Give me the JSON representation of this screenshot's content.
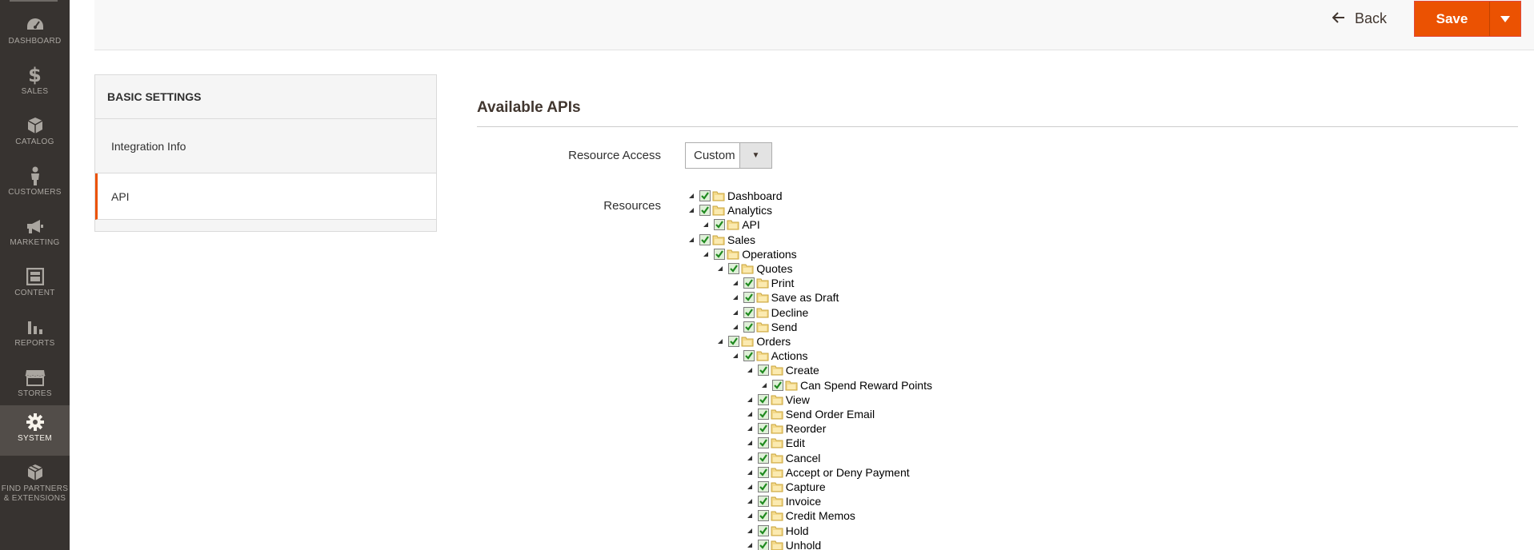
{
  "sidebar": {
    "items": [
      {
        "label": "DASHBOARD",
        "icon": "dashboard-icon"
      },
      {
        "label": "SALES",
        "icon": "dollar-icon"
      },
      {
        "label": "CATALOG",
        "icon": "box-icon"
      },
      {
        "label": "CUSTOMERS",
        "icon": "person-icon"
      },
      {
        "label": "MARKETING",
        "icon": "megaphone-icon"
      },
      {
        "label": "CONTENT",
        "icon": "layout-icon"
      },
      {
        "label": "REPORTS",
        "icon": "bar-chart-icon"
      },
      {
        "label": "STORES",
        "icon": "storefront-icon"
      },
      {
        "label": "SYSTEM",
        "icon": "gear-icon",
        "active": true
      },
      {
        "label": "FIND PARTNERS & EXTENSIONS",
        "icon": "extensions-box-icon"
      }
    ]
  },
  "header": {
    "back_label": "Back",
    "save_label": "Save"
  },
  "tabs": {
    "title": "BASIC SETTINGS",
    "items": [
      {
        "label": "Integration Info",
        "active": false
      },
      {
        "label": "API",
        "active": true
      }
    ]
  },
  "main": {
    "section_title": "Available APIs",
    "resource_access_label": "Resource Access",
    "resource_access_value": "Custom",
    "resources_label": "Resources"
  },
  "tree": [
    {
      "label": "Dashboard",
      "depth": 0,
      "checked": true
    },
    {
      "label": "Analytics",
      "depth": 0,
      "checked": true
    },
    {
      "label": "API",
      "depth": 1,
      "checked": true
    },
    {
      "label": "Sales",
      "depth": 0,
      "checked": true
    },
    {
      "label": "Operations",
      "depth": 1,
      "checked": true
    },
    {
      "label": "Quotes",
      "depth": 2,
      "checked": true
    },
    {
      "label": "Print",
      "depth": 3,
      "checked": true
    },
    {
      "label": "Save as Draft",
      "depth": 3,
      "checked": true
    },
    {
      "label": "Decline",
      "depth": 3,
      "checked": true
    },
    {
      "label": "Send",
      "depth": 3,
      "checked": true
    },
    {
      "label": "Orders",
      "depth": 2,
      "checked": true
    },
    {
      "label": "Actions",
      "depth": 3,
      "checked": true
    },
    {
      "label": "Create",
      "depth": 4,
      "checked": true
    },
    {
      "label": "Can Spend Reward Points",
      "depth": 5,
      "checked": true
    },
    {
      "label": "View",
      "depth": 4,
      "checked": true
    },
    {
      "label": "Send Order Email",
      "depth": 4,
      "checked": true
    },
    {
      "label": "Reorder",
      "depth": 4,
      "checked": true
    },
    {
      "label": "Edit",
      "depth": 4,
      "checked": true
    },
    {
      "label": "Cancel",
      "depth": 4,
      "checked": true
    },
    {
      "label": "Accept or Deny Payment",
      "depth": 4,
      "checked": true
    },
    {
      "label": "Capture",
      "depth": 4,
      "checked": true
    },
    {
      "label": "Invoice",
      "depth": 4,
      "checked": true
    },
    {
      "label": "Credit Memos",
      "depth": 4,
      "checked": true
    },
    {
      "label": "Hold",
      "depth": 4,
      "checked": true
    },
    {
      "label": "Unhold",
      "depth": 4,
      "checked": true
    }
  ],
  "colors": {
    "accent": "#eb5202",
    "sidebar_bg": "#373330",
    "checkbox_green": "#2f8f2f"
  }
}
